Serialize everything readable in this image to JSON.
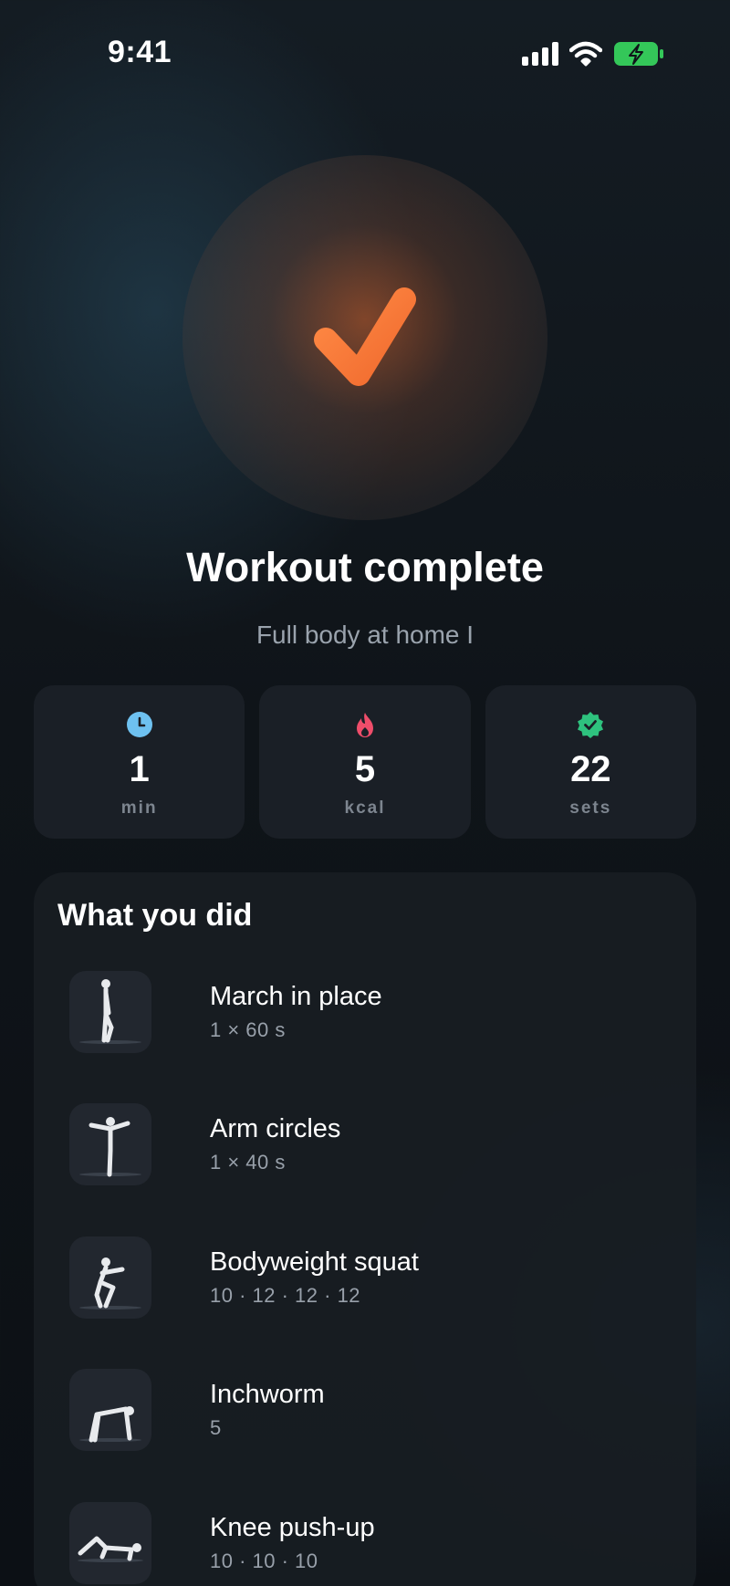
{
  "status_bar": {
    "time": "9:41"
  },
  "hero": {
    "title": "Workout complete",
    "subtitle": "Full body at home I"
  },
  "stats": [
    {
      "icon": "clock-icon",
      "value": "1",
      "unit": "min",
      "color": "#6ec1f0"
    },
    {
      "icon": "flame-icon",
      "value": "5",
      "unit": "kcal",
      "color": "#ef4d6a"
    },
    {
      "icon": "verified-badge-icon",
      "value": "22",
      "unit": "sets",
      "color": "#2ec27e"
    }
  ],
  "summary": {
    "title": "What you did",
    "exercises": [
      {
        "name": "March in place",
        "detail": "1 × 60 s"
      },
      {
        "name": "Arm circles",
        "detail": "1 × 40 s"
      },
      {
        "name": "Bodyweight squat",
        "detail": "10 · 12 · 12 · 12"
      },
      {
        "name": "Inchworm",
        "detail": "5"
      },
      {
        "name": "Knee push-up",
        "detail": "10 · 10 · 10"
      }
    ]
  },
  "colors": {
    "accent": "#f47a3a",
    "battery": "#34c759"
  }
}
